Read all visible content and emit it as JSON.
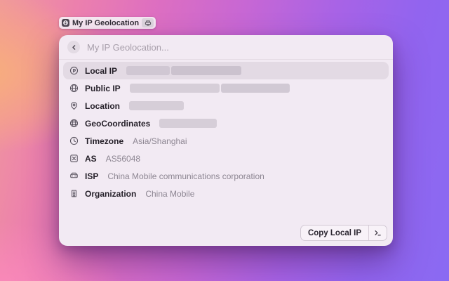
{
  "tag": {
    "label": "My IP Geolocation"
  },
  "search": {
    "placeholder": "My IP Geolocation..."
  },
  "rows": [
    {
      "icon": "ip-badge-icon",
      "label": "Local IP",
      "redacted": [
        62,
        100
      ],
      "selected": true
    },
    {
      "icon": "globe-icon",
      "label": "Public IP",
      "redacted": [
        128,
        98
      ]
    },
    {
      "icon": "map-pin-icon",
      "label": "Location",
      "redacted": [
        78
      ]
    },
    {
      "icon": "globe-grid-icon",
      "label": "GeoCoordinates",
      "redacted": [
        82
      ]
    },
    {
      "icon": "clock-icon",
      "label": "Timezone",
      "value": "Asia/Shanghai"
    },
    {
      "icon": "boxed-x-icon",
      "label": "AS",
      "value": "AS56048"
    },
    {
      "icon": "server-icon",
      "label": "ISP",
      "value": "China Mobile communications corporation"
    },
    {
      "icon": "building-icon",
      "label": "Organization",
      "value": "China Mobile"
    }
  ],
  "footer": {
    "copy_button": "Copy Local IP"
  },
  "colors": {
    "accent_purple": "#8a6af2",
    "accent_pink": "#ec80ad",
    "accent_orange": "#f5ab7f",
    "panel_bg": "#f2eaf3",
    "selected_row_bg": "#e3dae4",
    "redacted_bar": "#d6ced8"
  }
}
